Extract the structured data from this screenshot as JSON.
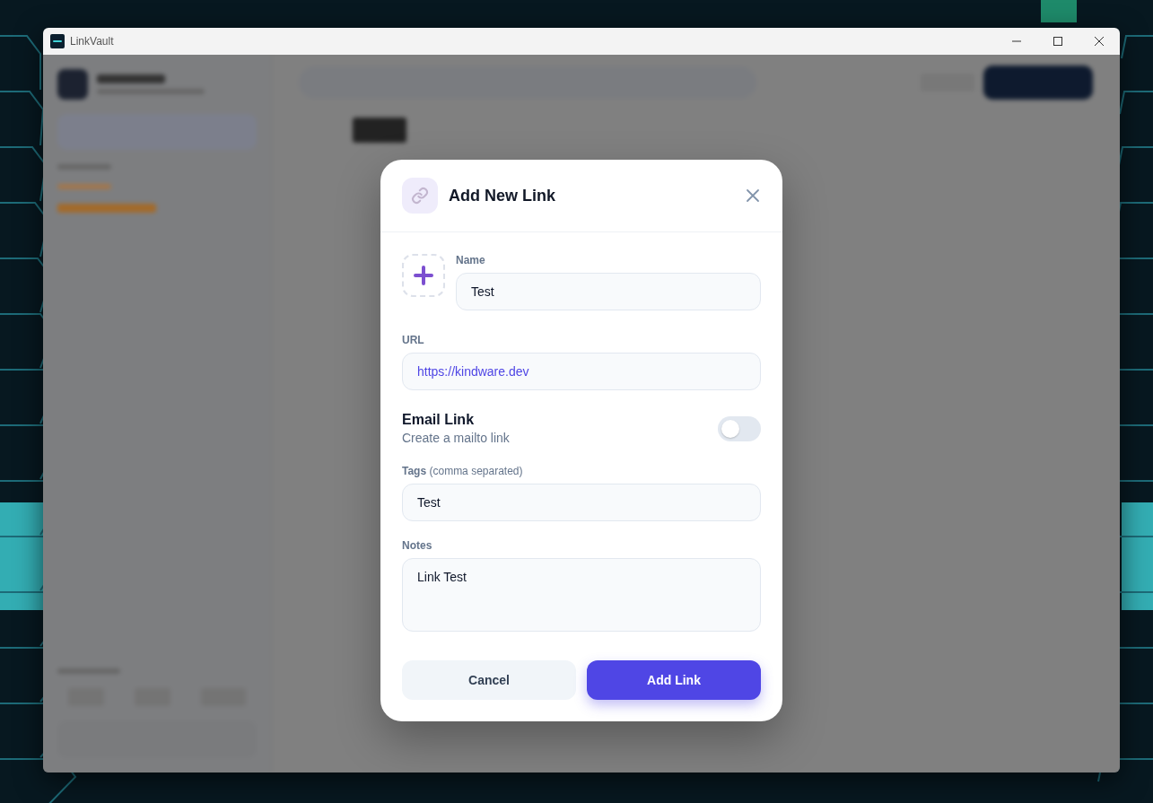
{
  "window": {
    "title": "LinkVault"
  },
  "dialog": {
    "title": "Add New Link",
    "fields": [
      {
        "kind": "name",
        "label": "Name",
        "value": "Test"
      },
      {
        "kind": "url",
        "label": "URL",
        "value": "https://kindware.dev"
      },
      {
        "kind": "toggle",
        "label": "Email Link",
        "hint": "Create a mailto link",
        "on": false
      },
      {
        "kind": "input",
        "label": "**Tags** (comma separated)",
        "value": "Test"
      },
      {
        "kind": "textarea",
        "label": "Notes",
        "value": "Link Test"
      }
    ],
    "buttons": [
      {
        "kind": "secondary",
        "label": "Cancel"
      },
      {
        "kind": "primary",
        "label": "Add Link"
      }
    ]
  }
}
